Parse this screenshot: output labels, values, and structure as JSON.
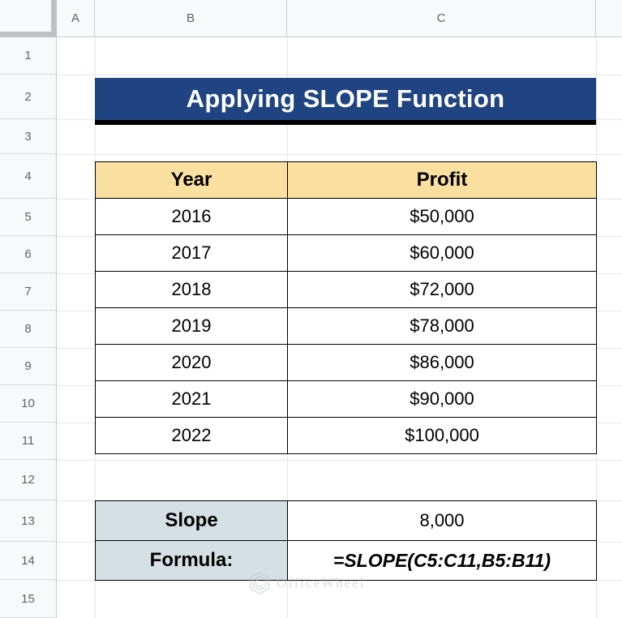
{
  "spreadsheet": {
    "column_headers": [
      "A",
      "B",
      "C"
    ],
    "row_headers": [
      "1",
      "2",
      "3",
      "4",
      "5",
      "6",
      "7",
      "8",
      "9",
      "10",
      "11",
      "12",
      "13",
      "14",
      "15"
    ]
  },
  "title_banner": {
    "text": "Applying SLOPE Function",
    "background_color": "#1f4481",
    "text_color": "#ffffff",
    "underline_color": "#000000"
  },
  "data_table": {
    "headers": [
      "Year",
      "Profit"
    ],
    "header_fill": "#fae0a0",
    "rows": [
      {
        "year": "2016",
        "profit": "$50,000"
      },
      {
        "year": "2017",
        "profit": "$60,000"
      },
      {
        "year": "2018",
        "profit": "$72,000"
      },
      {
        "year": "2019",
        "profit": "$78,000"
      },
      {
        "year": "2020",
        "profit": "$86,000"
      },
      {
        "year": "2021",
        "profit": "$90,000"
      },
      {
        "year": "2022",
        "profit": "$100,000"
      }
    ]
  },
  "result_table": {
    "label_fill": "#d4e0e4",
    "slope_label": "Slope",
    "slope_value": "8,000",
    "formula_label": "Formula:",
    "formula_value": "=SLOPE(C5:C11,B5:B11)"
  },
  "watermark": {
    "text": "OfficeWheel"
  }
}
